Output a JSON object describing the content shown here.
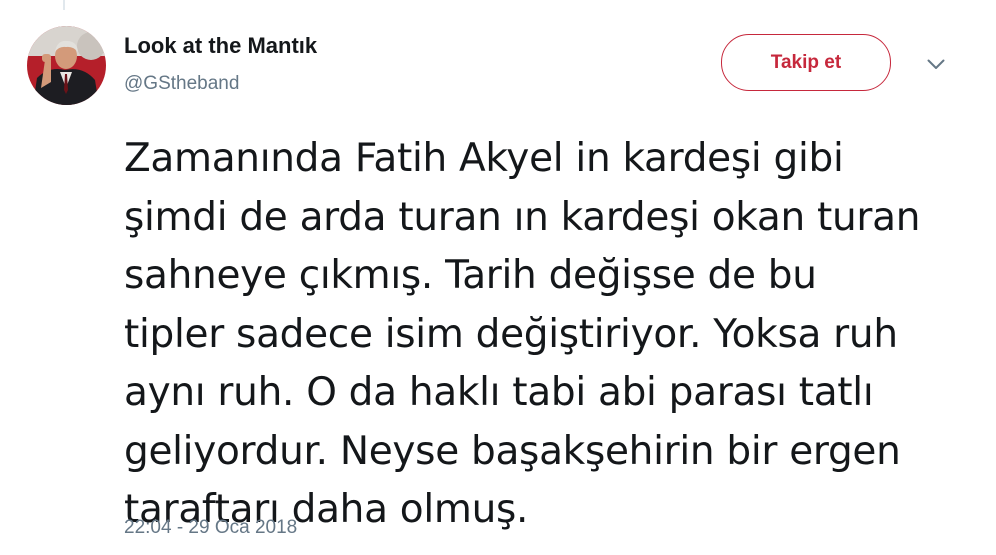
{
  "tweet": {
    "author": {
      "display_name": "Look at the Mantık",
      "handle": "@GStheband",
      "avatar_icon": "profile-photo"
    },
    "follow_label": "Takip et",
    "more_icon": "chevron-down-icon",
    "text_lines": [
      "Zamanında Fatih Akyel in kardeşi gibi",
      "şimdi de arda turan ın kardeşi okan turan",
      "sahneye çıkmış. Tarih değişse de bu",
      "tipler sadece isim değiştiriyor. Yoksa ruh",
      "aynı ruh. O da haklı tabi abi parası tatlı",
      "geliyordur. Neyse başakşehirin bir ergen",
      "taraftarı daha olmuş."
    ],
    "timestamp": "22:04 - 29 Oca 2018"
  },
  "colors": {
    "accent": "#c6283c",
    "text_primary": "#14171a",
    "text_secondary": "#657786"
  }
}
